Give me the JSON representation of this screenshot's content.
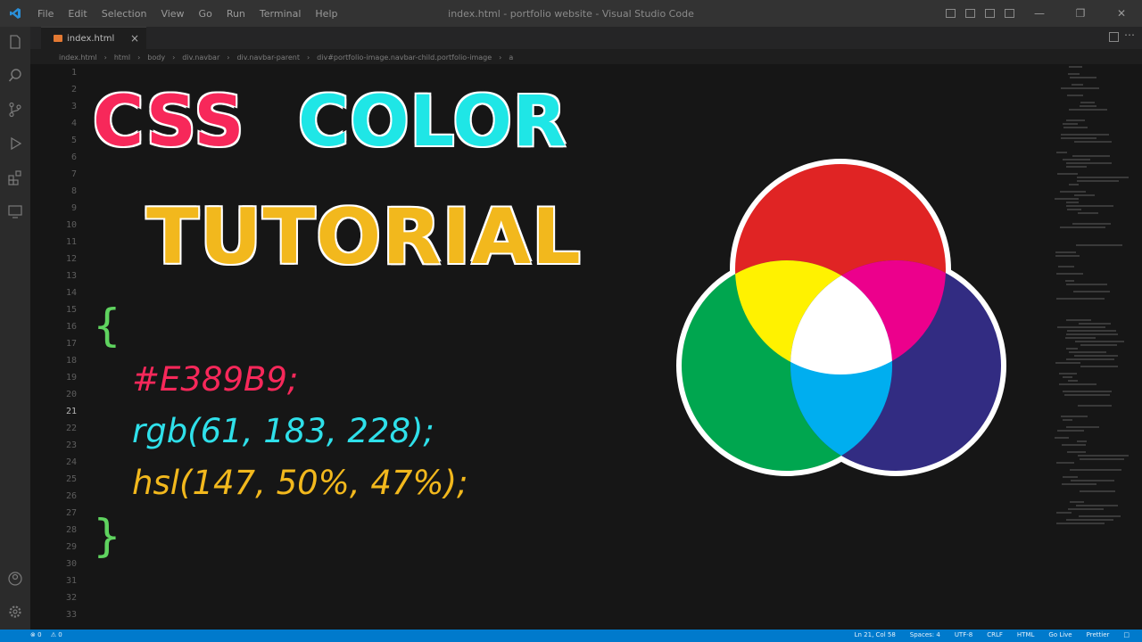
{
  "window": {
    "title": "index.html - portfolio website - Visual Studio Code",
    "menu": [
      "File",
      "Edit",
      "Selection",
      "View",
      "Go",
      "Run",
      "Terminal",
      "Help"
    ]
  },
  "tab": {
    "label": "index.html",
    "close": "×"
  },
  "breadcrumb": [
    "index.html",
    "html",
    "body",
    "div.navbar",
    "div.navbar-parent",
    "div#portfolio-image.navbar-child.portfolio-image",
    "a"
  ],
  "editor": {
    "line_count": 33,
    "active_line": 21
  },
  "thumbnail": {
    "title_word1": "CSS",
    "title_word2": "COLOR",
    "title_line2": "TUTORIAL",
    "open_brace": "{",
    "close_brace": "}",
    "code_hex": "#E389B9;",
    "code_rgb": "rgb(61, 183, 228);",
    "code_hsl": "hsl(147, 50%, 47%);"
  },
  "status_bar": {
    "errors": "0",
    "warnings": "0",
    "cursor": "Ln 21, Col 58",
    "spaces": "Spaces: 4",
    "encoding": "UTF-8",
    "eol": "CRLF",
    "language": "HTML",
    "go_live": "Go Live",
    "prettier": "Prettier"
  },
  "colors": {
    "accent": "#007acc",
    "title_css": "#f7285a",
    "title_color": "#1fe6e6",
    "title_tutorial": "#f2b81d",
    "brace": "#5fd35f",
    "venn_red": "#e02424",
    "venn_green": "#00a64f",
    "venn_blue": "#322c82",
    "venn_yellow": "#fff200",
    "venn_magenta": "#ec008c",
    "venn_cyan": "#00aeef",
    "venn_white": "#ffffff"
  }
}
